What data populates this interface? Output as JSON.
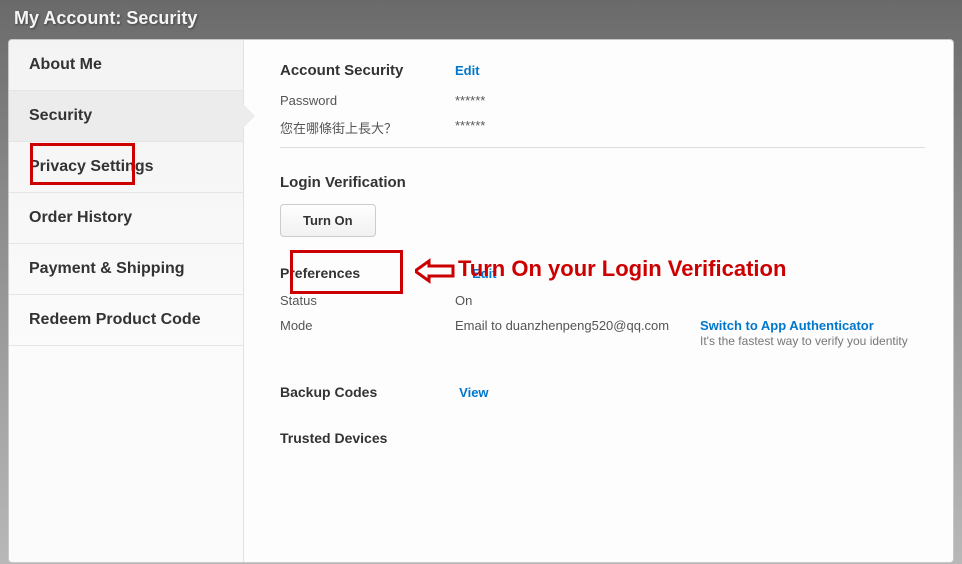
{
  "page": {
    "title": "My Account: Security"
  },
  "sidebar": {
    "items": [
      {
        "label": "About Me",
        "active": false
      },
      {
        "label": "Security",
        "active": true
      },
      {
        "label": "Privacy Settings",
        "active": false
      },
      {
        "label": "Order History",
        "active": false
      },
      {
        "label": "Payment & Shipping",
        "active": false
      },
      {
        "label": "Redeem Product Code",
        "active": false
      }
    ]
  },
  "account_security": {
    "heading": "Account Security",
    "edit_label": "Edit",
    "password_label": "Password",
    "password_value": "******",
    "question_label": "您在哪條街上長大？",
    "question_value": "******"
  },
  "login_verification": {
    "heading": "Login Verification",
    "turn_on_label": "Turn On"
  },
  "preferences": {
    "heading": "Preferences",
    "edit_label": "Edit",
    "status_label": "Status",
    "status_value": "On",
    "mode_label": "Mode",
    "mode_value": "Email to duanzhenpeng520@qq.com",
    "switch_label": "Switch to App Authenticator",
    "switch_sub": "It's the fastest way to verify you identity"
  },
  "backup_codes": {
    "heading": "Backup Codes",
    "view_label": "View"
  },
  "trusted_devices": {
    "heading": "Trusted Devices"
  },
  "annotations": {
    "callout": "Turn On your Login Verification"
  }
}
